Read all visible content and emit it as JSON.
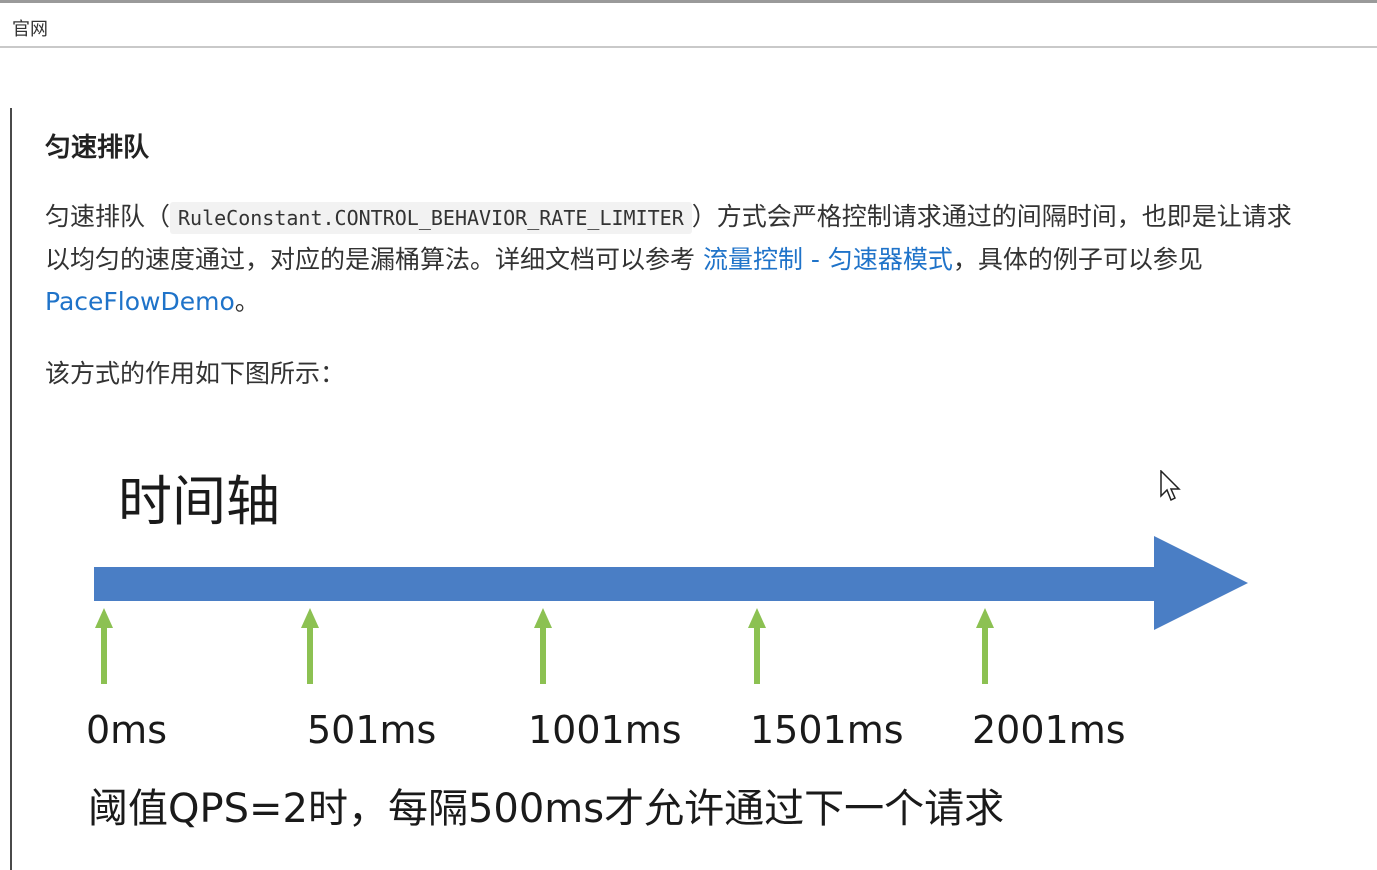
{
  "top_bar": {
    "label": "官网"
  },
  "section": {
    "heading": "匀速排队",
    "paragraph": {
      "text_before_code": "匀速排队（",
      "code": "RuleConstant.CONTROL_BEHAVIOR_RATE_LIMITER",
      "text_after_code": "）方式会严格控制请求通过的间隔时间，也即是让请求以均匀的速度通过，对应的是漏桶算法。详细文档可以参考 ",
      "link1": "流量控制 - 匀速器模式",
      "text_between_links": "，具体的例子可以参见 ",
      "link2": "PaceFlowDemo",
      "text_end": "。"
    },
    "caption": "该方式的作用如下图所示："
  },
  "figure": {
    "title": "时间轴",
    "tick_labels": [
      "0ms",
      "501ms",
      "1001ms",
      "1501ms",
      "2001ms"
    ],
    "footer": "阈值QPS=2时，每隔500ms才允许通过下一个请求",
    "axis_color": "#4a7ec5",
    "arrow_color": "#8cc152"
  }
}
